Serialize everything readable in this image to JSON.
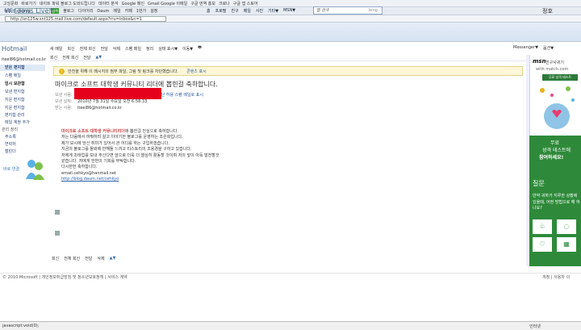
{
  "browser": {
    "bookmarks": [
      "고잉문화",
      "바로가기",
      "네이트 파워 블로그 도와드립니다",
      "데이터 분석",
      "Google 메인",
      "Gmail Google 이메일",
      "구글 번역 홍보",
      "크로나",
      "구글 앱 스토어"
    ],
    "toolbar_search_value": "searcg",
    "toolbar_go": "검색",
    "toolbar_items": [
      "뉴스",
      "블로그",
      "다이어리",
      "Daum",
      "메일",
      "카페",
      "1번가",
      "설정"
    ],
    "address": "http://sn125w.snt125.mail.live.com/default.aspx?rru=inbox&n=1",
    "status_left": "javascript:void(0);",
    "status_right": "인터넷"
  },
  "header": {
    "logo": "Windows Live™",
    "nav": [
      "홈",
      "프로필",
      "친구",
      "메일",
      "사진",
      "기타▼",
      "MSN▼"
    ],
    "search_placeholder": "웹 검색",
    "search_brand": "bing",
    "user": "정호"
  },
  "sidebar": {
    "title": "Hotmail",
    "account": "iteel86@hotmail.co.kr",
    "items": [
      {
        "label": "받은 편지함",
        "selected": true
      },
      {
        "label": "스팸 메일",
        "selected": false
      },
      {
        "label": "임시 보관함",
        "selected": false
      },
      {
        "label": "보낸 편지함",
        "selected": false
      },
      {
        "label": "지운 편지함",
        "selected": false
      },
      {
        "label": "지운 편지함",
        "selected": false
      },
      {
        "label": "편지함 관리",
        "selected": false
      },
      {
        "label": "메일 계정 추가",
        "selected": false
      }
    ],
    "manage_title": "관리 정리",
    "manage_items": [
      "주소록",
      "연락처",
      "캘린더"
    ],
    "messenger": "바로 연결"
  },
  "main": {
    "menu": [
      "새 메일",
      "회신",
      "전체 회신",
      "전달",
      "삭제",
      "스팸 메일",
      "정리",
      "상태 표시▼",
      "이동▼"
    ],
    "right_tools": [
      "Messenger▼",
      "옵션▼"
    ],
    "msg_tools": [
      "회신",
      "전체 회신",
      "전달"
    ],
    "warning": "안전을 위해 이 메시지의 첨부 파일, 그림 및 링크를 차단했습니다.",
    "warning_link": "콘텐츠 표시",
    "subject": "마이크로 소프트 대학생 커뮤니티 리더에 뽑힌걸 축하합니다.",
    "meta": {
      "from_label": "보낸 사람:",
      "from_extra": "보안 목록에 추가   차단 허용   스팸 메일로 표시",
      "date_label": "보낸 날짜:",
      "date": "2010년 7월 31일 수요일 오전 6:58:33",
      "to_label": "받는 사람:",
      "to": "iteel86@hotmail.co.kr"
    },
    "body_highlight": "마이크로 소프트 대학생 커뮤니티리더",
    "body_first_suffix": "에 뽑힌걸 진심으로 축하합니다.",
    "body_lines": [
      "저는 다음에서 여쭤하려 살고 이야기한 블로그를 운영하는 조은희입니다.",
      "제가 보시에 당신 취미가 있어서 관 어디를 하는 구입하겠습니다.",
      "지금의 블로그를 돌봐에 반해들 느끼고 티스토리의 조용경을 구하고 있습니다.",
      "저에게 조태업를 보내 주신다면 앞으로 더욱 더 열심히 활동할 것이며 저의 앞이 아독 발전할것",
      "같습니다. 저에게 한번의 기회를 부탁합니다.",
      "다시한번 축하합니다."
    ],
    "body_email": "email.cehkyo@hanmail.net",
    "body_link": "http://blog.daum.net/cehkyo",
    "bottom_tools": [
      "회신",
      "전체 회신",
      "전달",
      "삭제"
    ]
  },
  "ad": {
    "brand": "msn",
    "brand_sub": "친구사귀기",
    "match": "with match.com",
    "button": "무료 성격 테스트",
    "green_line1": "무료",
    "green_line2": "성격 테스트에",
    "green_line3": "참여하세요!",
    "question": "질문",
    "question_text": "만약 귀하가 지루한 상황에 있을때, 어떤 방법으로 해 하나요?"
  },
  "footer": {
    "left": "© 2010 Microsoft | 개인정보취급방침 및 청소년보호정책 | 서비스 계약",
    "right": "게정 | 사용자 의"
  }
}
